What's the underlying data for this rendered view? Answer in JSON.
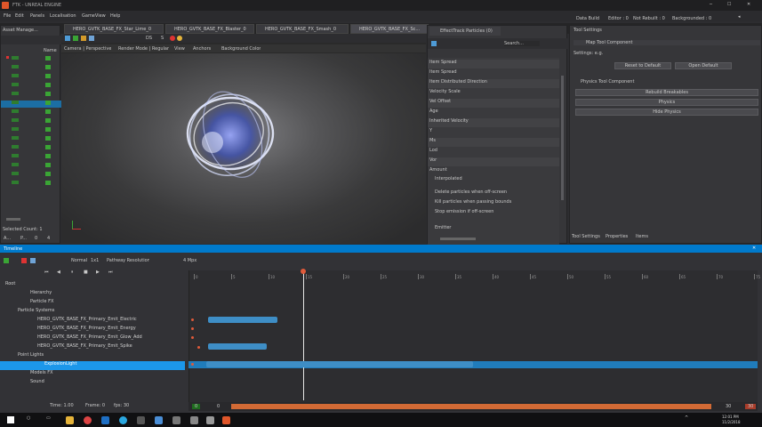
{
  "window": {
    "title": "FTK - UNREAL ENGINE",
    "controls": [
      "minimize",
      "maximize",
      "close"
    ]
  },
  "menu": [
    "File",
    "Edit",
    "Panels",
    "Localisation",
    "GameView",
    "Help"
  ],
  "status": {
    "data_build": "Data Build",
    "editor": "Editor : 0",
    "not_rebuilt": "Not Rebuilt : 0",
    "backgrounded": "Backgrounded : 0"
  },
  "asset_panel": {
    "title": "Asset Manage...",
    "col_label": "Name",
    "selected_count": "Selected Count: 1",
    "footer_a": "A...",
    "footer_b": "P...",
    "footer_c": "0",
    "footer_d": "4"
  },
  "doc_tabs": [
    "HERO_GVTK_BASE_FX_Star_Lime_0",
    "HERO_GVTK_BASE_FX_Blaster_0",
    "HERO_GVTK_BASE_FX_Smash_0",
    "HERO_GVTK_BASE_FX_Sc..."
  ],
  "viewport": {
    "toolbar": [
      "Camera | Perspective",
      "Render Mode | Regular",
      "View",
      "Anchors",
      "Background Color"
    ],
    "fps": "DS",
    "speed": "S"
  },
  "particle_editor": {
    "title": "EffectTrack Particles (0)",
    "search": "Search...",
    "props": [
      "Item Spread",
      "Item Spread",
      "Item Distributed Direction",
      "Velocity Scale",
      "Vel Offset",
      "Age",
      "Inherited Velocity",
      "Y",
      "Ms",
      "Lod",
      "Vor",
      "Amount",
      "Interpolated"
    ],
    "checks": [
      "Delete particles when off-screen",
      "Kill particles when passing bounds",
      "Stop emission if off-screen"
    ],
    "footer": "Emitter"
  },
  "tool_settings": {
    "title": "Tool Settings",
    "header": "Map Tool Component",
    "field": "Settings: e.g.",
    "btn_default": "Reset to Default",
    "btn_reload": "Open Default",
    "section": "Physics Tool Component",
    "btn_rebuild": "Rebuild Breakables",
    "btn_physics": "Physics",
    "btn_hide": "Hide Physics",
    "tabs": [
      "Tool Settings",
      "Properties",
      "Items"
    ]
  },
  "timeline": {
    "title": "Timeline",
    "controls": [
      "Normal",
      "1x1",
      "Pathway Resolution"
    ],
    "zoom": "4 Mpx",
    "ruler": [
      "0",
      "5",
      "10",
      "15",
      "20",
      "25",
      "30",
      "35",
      "40",
      "45",
      "50",
      "55",
      "60",
      "65",
      "70",
      "75"
    ],
    "tracks": [
      {
        "label": "Root",
        "level": 0
      },
      {
        "label": "Hierarchy",
        "level": 1
      },
      {
        "label": "Particle FX",
        "level": 1
      },
      {
        "label": "Particle Systems",
        "level": 2
      },
      {
        "label": "HERO_GVTK_BASE_FX_Primary_Emit_Electric",
        "level": 3
      },
      {
        "label": "HERO_GVTK_BASE_FX_Primary_Emit_Energy",
        "level": 3
      },
      {
        "label": "HERO_GVTK_BASE_FX_Primary_Emit_Glow_Add",
        "level": 3
      },
      {
        "label": "HERO_GVTK_BASE_FX_Primary_Emit_Spike",
        "level": 3
      },
      {
        "label": "Point Lights",
        "level": 2
      },
      {
        "label": "ExplosionLight",
        "level": 3
      },
      {
        "label": "Models FX",
        "level": 1
      },
      {
        "label": "Sound",
        "level": 1
      }
    ],
    "timeinfo": {
      "time": "Time: 1.00",
      "frame": "Frame: 0",
      "fps": "fps: 30"
    },
    "range_start": "0",
    "range_a": "0",
    "range_end": "30",
    "range_end2": "30"
  },
  "taskbar": {
    "time": "12:01 PM",
    "date": "11/2/2018"
  },
  "colors": {
    "accent": "#007acc",
    "selection": "#1c97ea",
    "key": "#e05a3a",
    "bar": "#3e8ec6"
  }
}
